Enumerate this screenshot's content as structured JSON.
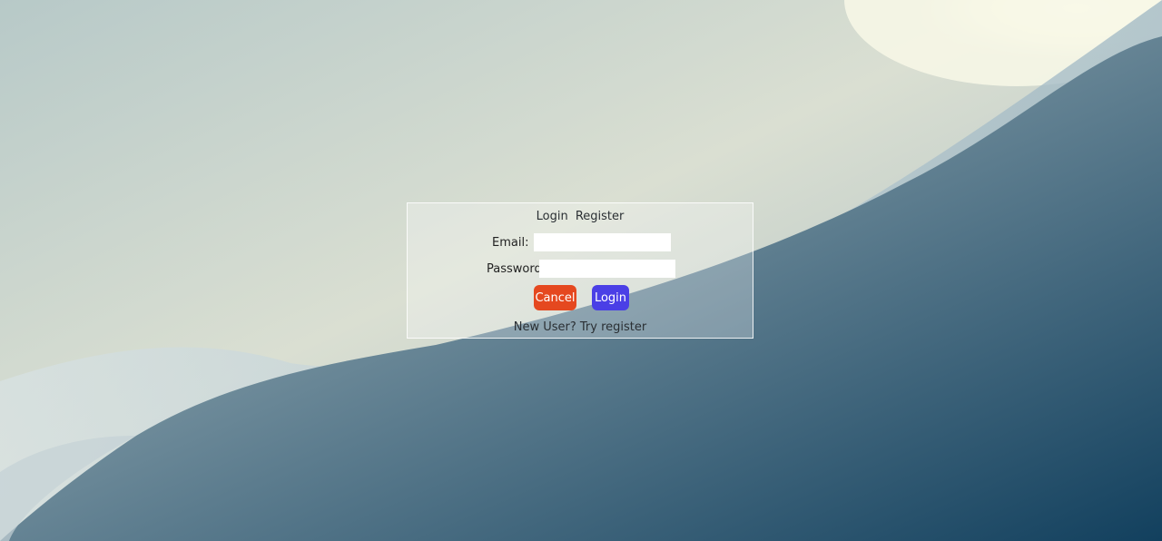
{
  "tabs": {
    "login": "Login",
    "register": "Register"
  },
  "form": {
    "email_label": "Email:",
    "email_value": "",
    "password_label": "Password:",
    "password_value": ""
  },
  "buttons": {
    "cancel": "Cancel",
    "login": "Login"
  },
  "footer": {
    "register_prompt": "New User? Try register"
  },
  "colors": {
    "cancel_button": "#e5481f",
    "login_button": "#4a3fe6",
    "panel_border": "#ffffff"
  }
}
